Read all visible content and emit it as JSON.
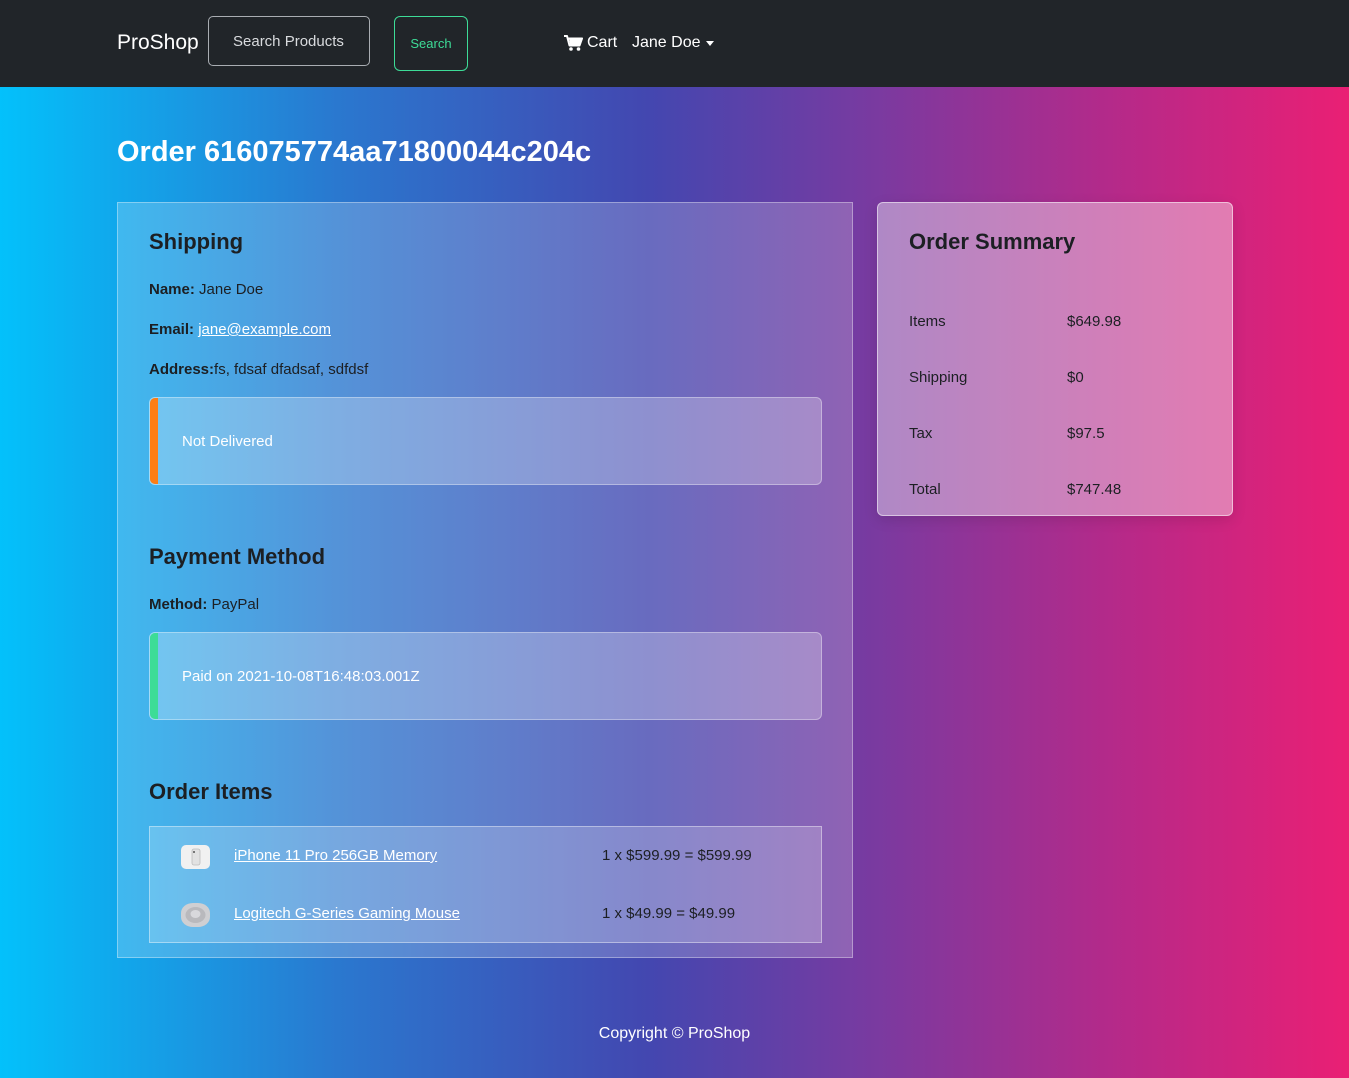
{
  "navbar": {
    "brand": "ProShop",
    "search_placeholder": "Search Products",
    "search_button": "Search",
    "cart_label": "Cart",
    "user_name": "Jane Doe"
  },
  "order": {
    "title": "Order 616075774aa71800044c204c"
  },
  "shipping": {
    "heading": "Shipping",
    "name_label": "Name:",
    "name_value": "Jane Doe",
    "email_label": "Email:",
    "email_value": "jane@example.com",
    "address_label": "Address:",
    "address_value": "fs, fdsaf dfadsaf, sdfdsf",
    "status": "Not Delivered",
    "status_color": "#fd7e14"
  },
  "payment": {
    "heading": "Payment Method",
    "method_label": "Method:",
    "method_value": "PayPal",
    "status": "Paid on 2021-10-08T16:48:03.001Z",
    "status_color": "#3ddc97"
  },
  "order_items": {
    "heading": "Order Items",
    "items": [
      {
        "name": "iPhone 11 Pro 256GB Memory",
        "price_line": "1 x $599.99 = $599.99",
        "thumb_icon": "phone-thumbnail"
      },
      {
        "name": "Logitech G-Series Gaming Mouse",
        "price_line": "1 x $49.99 = $49.99",
        "thumb_icon": "mouse-thumbnail"
      }
    ]
  },
  "summary": {
    "heading": "Order Summary",
    "rows": [
      {
        "label": "Items",
        "value": "$649.98"
      },
      {
        "label": "Shipping",
        "value": "$0"
      },
      {
        "label": "Tax",
        "value": "$97.5"
      },
      {
        "label": "Total",
        "value": "$747.48"
      }
    ]
  },
  "footer": {
    "copyright": "Copyright © ProShop"
  }
}
